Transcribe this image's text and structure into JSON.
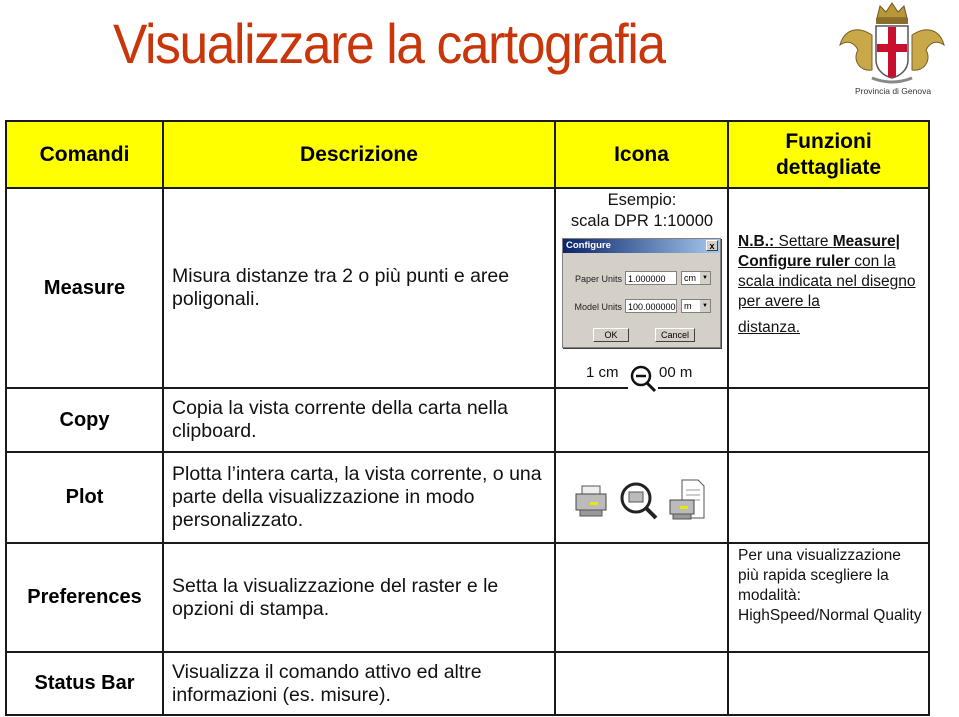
{
  "page": {
    "title": "Visualizzare la cartografia",
    "logo": {
      "icon": "provincia-di-genova-coat-of-arms-icon",
      "caption": "Provincia di Genova"
    }
  },
  "table": {
    "header_color": "#ffff00",
    "headers": {
      "commands": "Comandi",
      "description": "Descrizione",
      "icon": "Icona",
      "details_line1": "Funzioni",
      "details_line2": "dettagliate"
    },
    "rows": [
      {
        "command": "Measure",
        "description": "Misura distanze tra 2 o più punti e aree poligonali.",
        "icon_example_line1": "Esempio:",
        "icon_example_line2": "scala DPR 1:10000",
        "dialog": {
          "title": "Configure",
          "close": "x",
          "paper_units_label": "Paper Units",
          "paper_units_value": "1.000000",
          "paper_units_unit": "cm",
          "model_units_label": "Model Units",
          "model_units_value": "100.000000",
          "model_units_unit": "m",
          "ok_label": "OK",
          "cancel_label": "Cancel"
        },
        "scale_left": "1 cm",
        "scale_right": "00 m",
        "scale_icon": "zoom-out-icon",
        "details": {
          "nb": "N.B.:",
          "text1": " Settare  ",
          "measure": "Measure|",
          "configure_ruler": "Configure ruler",
          "text2": " con la scala indicata nel disegno per avere la",
          "text3": "distanza."
        }
      },
      {
        "command": "Copy",
        "description": "Copia la vista corrente della carta nella clipboard.",
        "details": ""
      },
      {
        "command": "Plot",
        "description": "Plotta l’intera carta, la vista corrente, o una parte della visualizzazione in modo personalizzato.",
        "icons": [
          "printer-icon",
          "print-preview-magnifier-icon",
          "print-document-icon"
        ],
        "details": ""
      },
      {
        "command": "Preferences",
        "description": "Setta la visualizzazione del raster e le opzioni di stampa.",
        "details": "Per una visualizzazione più rapida scegliere la modalità: HighSpeed/Normal Quality"
      },
      {
        "command": "Status Bar",
        "description": "Visualizza il comando attivo ed altre informazioni (es. misure).",
        "details": ""
      }
    ]
  }
}
